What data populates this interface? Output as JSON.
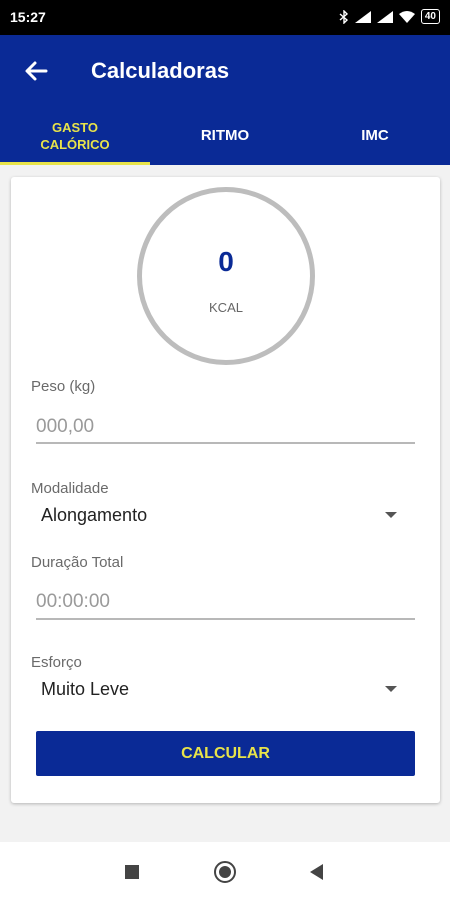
{
  "status_bar": {
    "time": "15:27",
    "battery": "40"
  },
  "app_bar": {
    "title": "Calculadoras"
  },
  "tabs": [
    {
      "label_line1": "GASTO",
      "label_line2": "CALÓRICO",
      "active": true
    },
    {
      "label": "RITMO",
      "active": false
    },
    {
      "label": "IMC",
      "active": false
    }
  ],
  "result": {
    "value": "0",
    "unit": "KCAL"
  },
  "form": {
    "peso": {
      "label": "Peso (kg)",
      "placeholder": "000,00"
    },
    "modalidade": {
      "label": "Modalidade",
      "value": "Alongamento"
    },
    "duracao": {
      "label": "Duração Total",
      "placeholder": "00:00:00"
    },
    "esforco": {
      "label": "Esforço",
      "value": "Muito Leve"
    }
  },
  "button": {
    "label": "CALCULAR"
  },
  "colors": {
    "primary": "#0a2a96",
    "accent": "#e8e34a"
  }
}
